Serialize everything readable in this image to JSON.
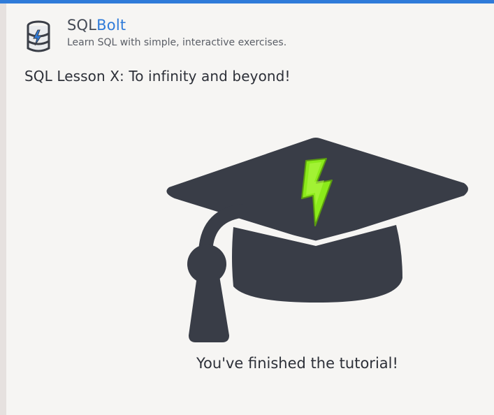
{
  "brand": {
    "name_part1": "SQL",
    "name_part2": "Bolt",
    "tagline": "Learn SQL with simple, interactive exercises.",
    "accent_color": "#2f7bd9"
  },
  "lesson": {
    "title": "SQL Lesson X: To infinity and beyond!"
  },
  "completion": {
    "message": "You've finished the tutorial!",
    "image_icon": "graduation-cap-icon",
    "bolt_icon": "lightning-bolt-icon",
    "cap_color": "#393d47",
    "bolt_color": "#8bea1a"
  },
  "logo_icon": "database-bolt-icon"
}
